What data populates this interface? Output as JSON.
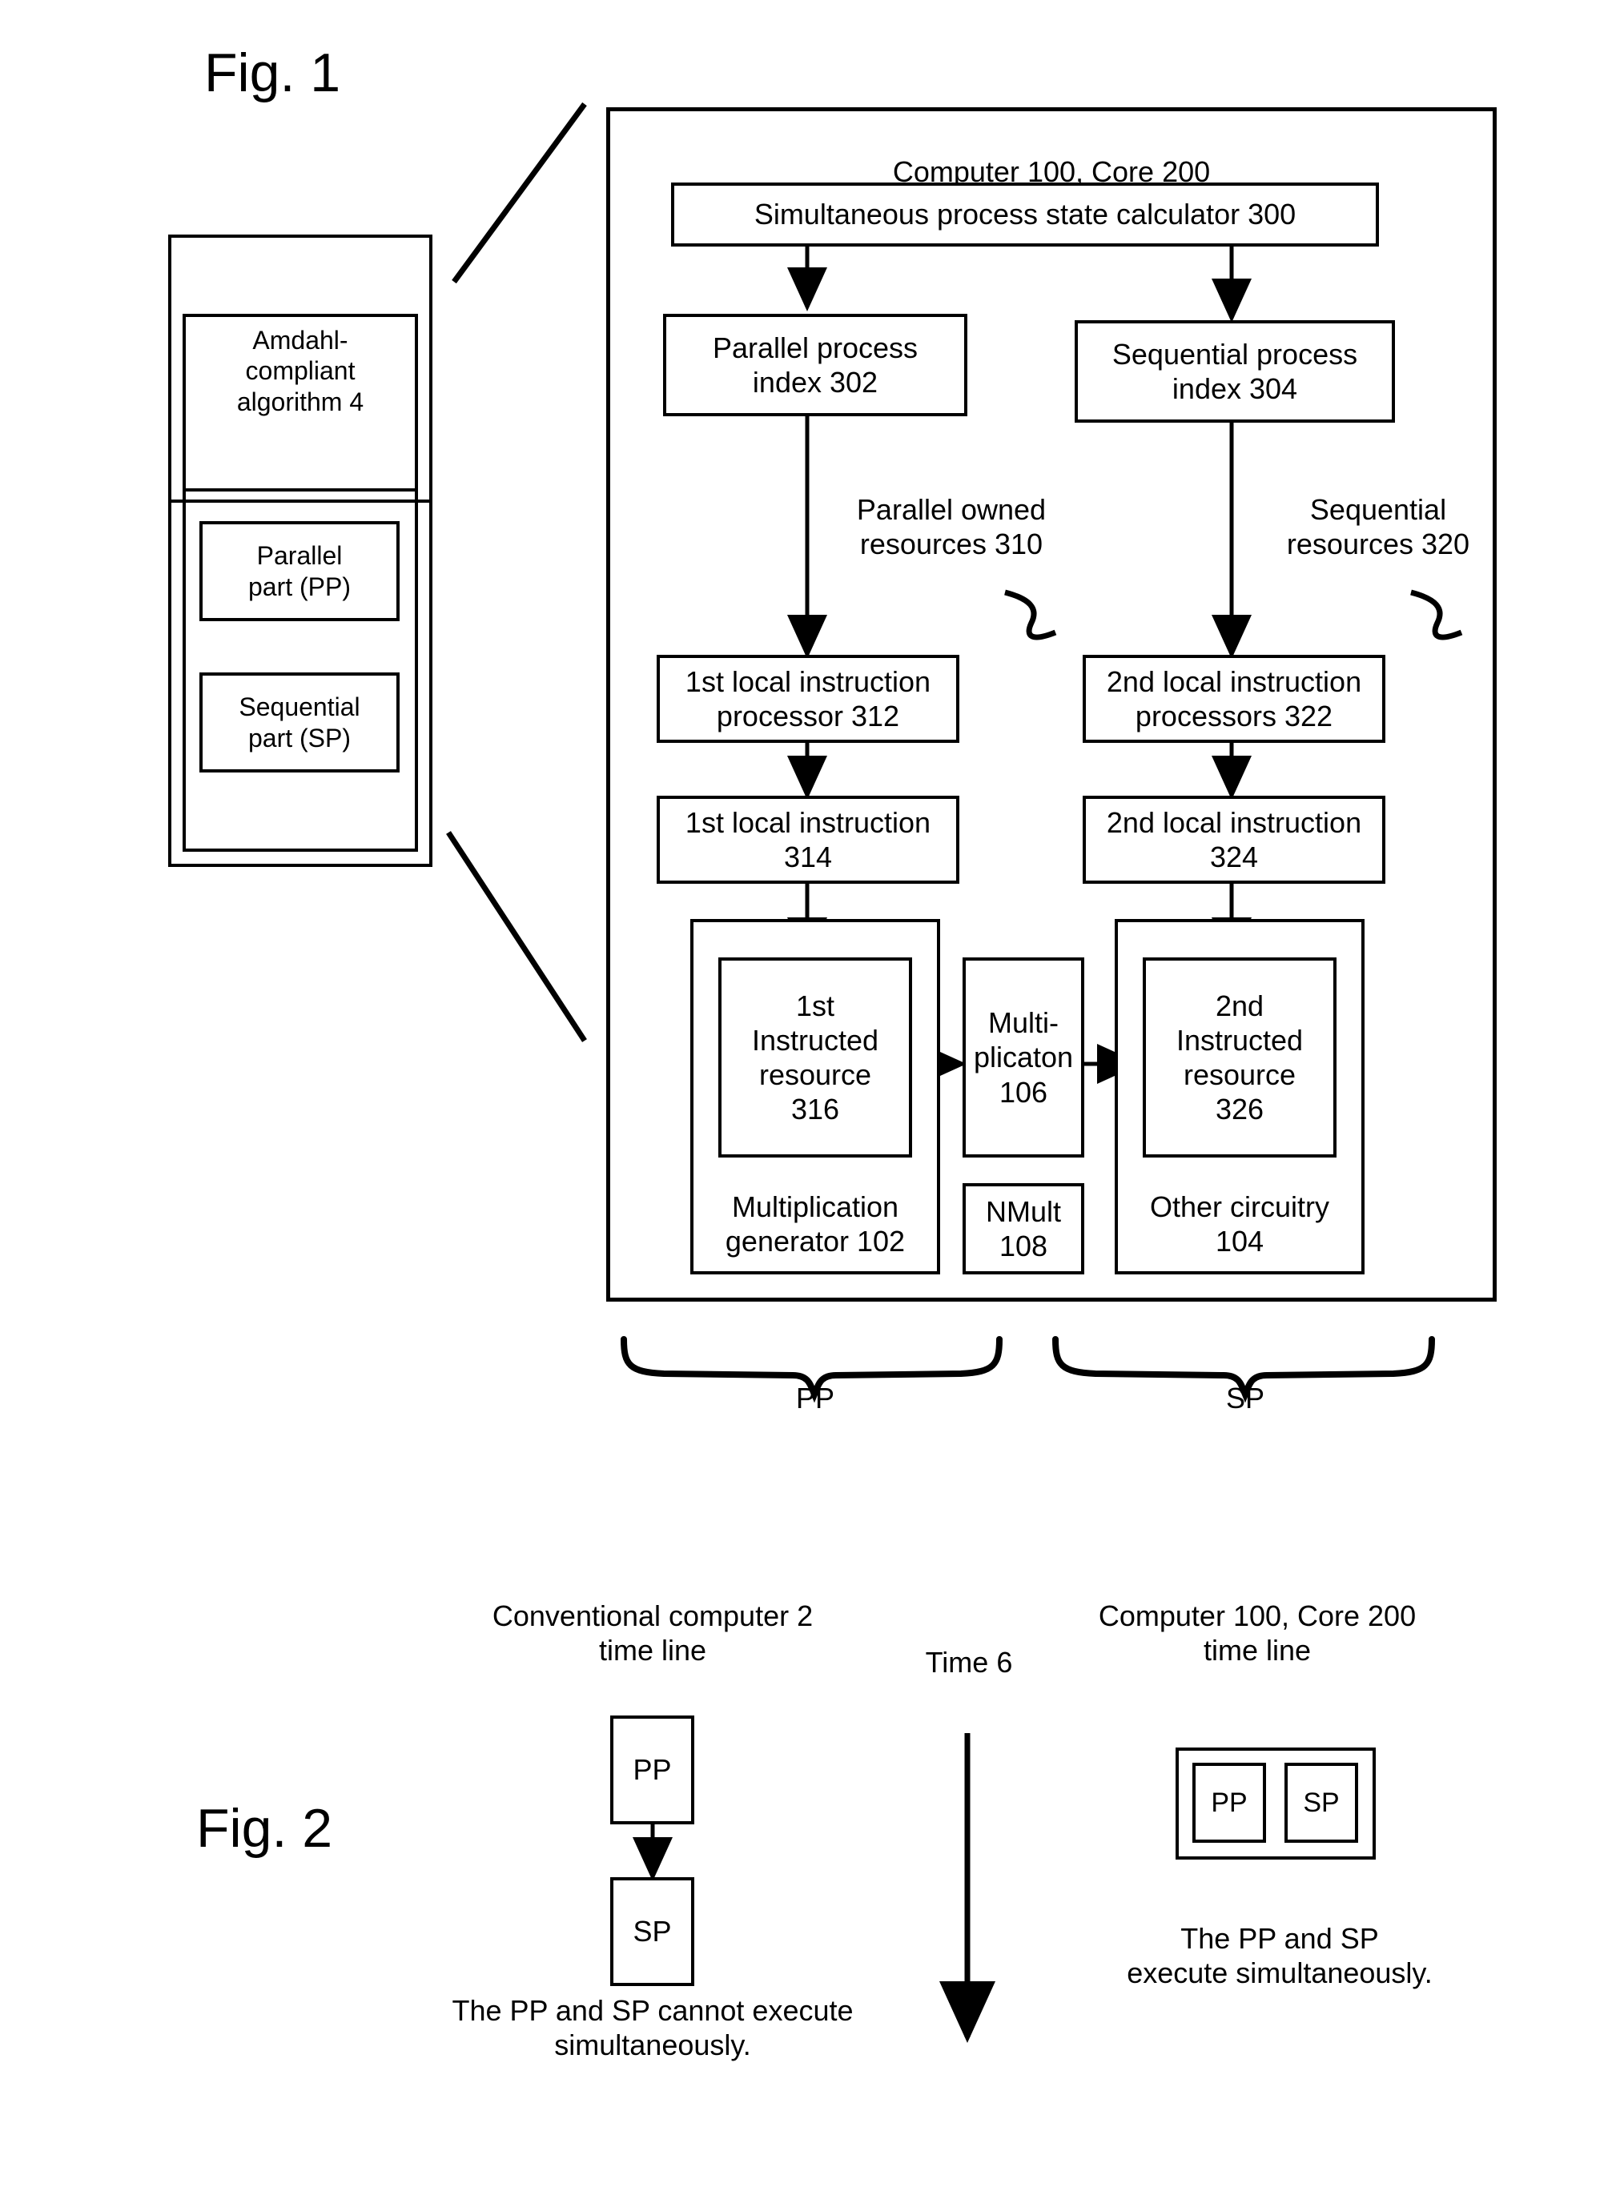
{
  "figures": {
    "fig1_label": "Fig. 1",
    "fig2_label": "Fig. 2"
  },
  "conventional_computer": {
    "title_line1": "Conventional",
    "title_line2": "computer",
    "title_ref": "2",
    "algorithm": "Amdahl-\ncompliant\nalgorithm 4",
    "parallel_part": "Parallel\npart (PP)",
    "sequential_part": "Sequential\npart (SP)"
  },
  "fig1": {
    "header_prefix": "Computer ",
    "header_ref1": "100",
    "header_mid": ", Core ",
    "header_ref2": "200",
    "calculator": "Simultaneous process state calculator 300",
    "parallel_index": "Parallel process\nindex 302",
    "sequential_index": "Sequential process\nindex 304",
    "parallel_owned_resources": "Parallel owned\nresources 310",
    "sequential_resources": "Sequential\nresources 320",
    "first_local_instruction_processor": "1st local instruction\nprocessor 312",
    "second_local_instruction_processors": "2nd local instruction\nprocessors 322",
    "first_local_instruction": "1st local instruction\n314",
    "second_local_instruction": "2nd local instruction\n324",
    "first_instructed_resource": "1st\nInstructed\nresource\n316",
    "second_instructed_resource": "2nd\nInstructed\nresource\n326",
    "multiplication_generator": "Multiplication\ngenerator 102",
    "other_circuitry": "Other circuitry\n104",
    "multiplicaton": "Multi-\nplicaton\n106",
    "nmult": "NMult\n108",
    "brace_pp_label": "PP",
    "brace_sp_label": "SP"
  },
  "fig2": {
    "left_title": "Conventional computer 2\ntime line",
    "right_title": "Computer 100, Core 200\ntime line",
    "time_axis_label": "Time 6",
    "left_pp": "PP",
    "left_sp": "SP",
    "right_pp": "PP",
    "right_sp": "SP",
    "left_caption": "The PP and SP cannot execute\nsimultaneously.",
    "right_caption": "The PP and SP\nexecute simultaneously."
  },
  "colors": {
    "ink": "#000000",
    "paper": "#ffffff"
  }
}
